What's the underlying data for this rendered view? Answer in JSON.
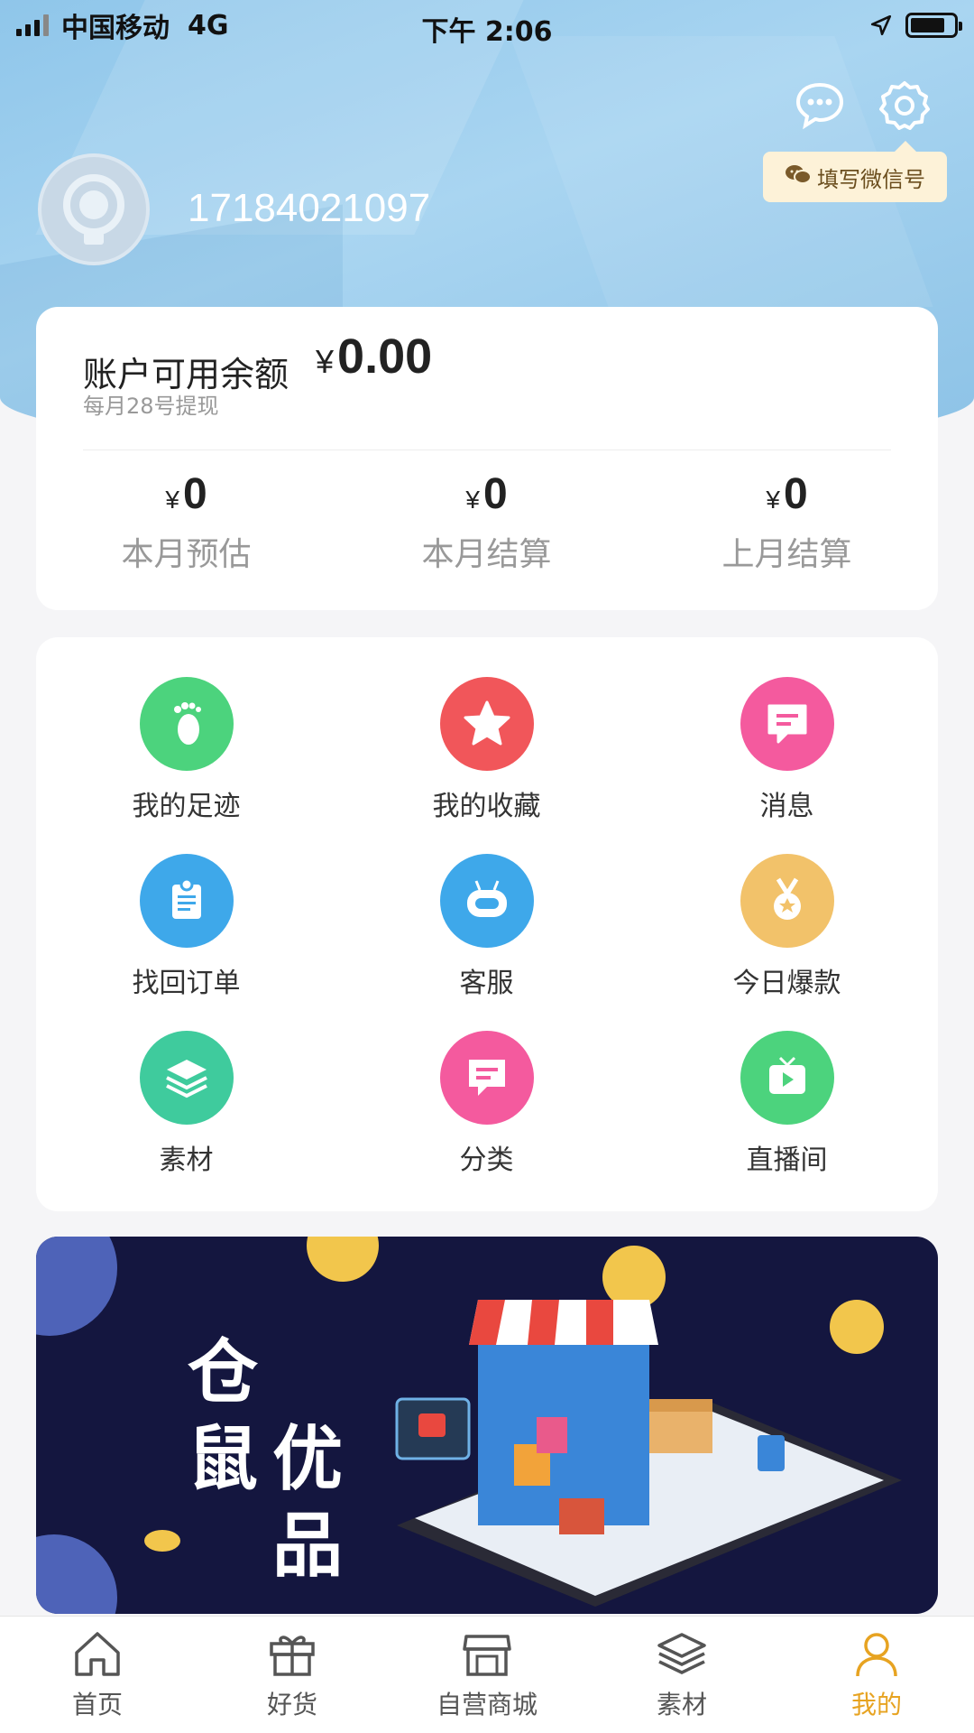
{
  "status": {
    "carrier": "中国移动",
    "network": "4G",
    "time": "下午 2:06"
  },
  "header": {
    "phone": "17184021097",
    "wechat_tip": "填写微信号"
  },
  "balance": {
    "label": "账户可用余额",
    "currency": "¥",
    "amount": "0.00",
    "withdraw_note": "每月28号提现",
    "stats": [
      {
        "currency": "¥",
        "value": "0",
        "label": "本月预估"
      },
      {
        "currency": "¥",
        "value": "0",
        "label": "本月结算"
      },
      {
        "currency": "¥",
        "value": "0",
        "label": "上月结算"
      }
    ]
  },
  "grid": [
    {
      "label": "我的足迹",
      "icon": "footprint-icon",
      "color": "#4cd37d"
    },
    {
      "label": "我的收藏",
      "icon": "star-icon",
      "color": "#f1565a"
    },
    {
      "label": "消息",
      "icon": "message-icon",
      "color": "#f45a9e"
    },
    {
      "label": "找回订单",
      "icon": "order-icon",
      "color": "#3ea8ea"
    },
    {
      "label": "客服",
      "icon": "robot-icon",
      "color": "#3ea8ea"
    },
    {
      "label": "今日爆款",
      "icon": "medal-icon",
      "color": "#f2c26a"
    },
    {
      "label": "素材",
      "icon": "layers-icon",
      "color": "#3fcb9d"
    },
    {
      "label": "分类",
      "icon": "category-icon",
      "color": "#f45a9e"
    },
    {
      "label": "直播间",
      "icon": "tv-icon",
      "color": "#4cd37d"
    }
  ],
  "banner": {
    "brand_lines": [
      "仓",
      "鼠",
      "优",
      "品"
    ]
  },
  "tabs": [
    {
      "label": "首页",
      "icon": "home-icon"
    },
    {
      "label": "好货",
      "icon": "gift-icon"
    },
    {
      "label": "自营商城",
      "icon": "store-icon"
    },
    {
      "label": "素材",
      "icon": "layers-icon"
    },
    {
      "label": "我的",
      "icon": "profile-icon",
      "active": true
    }
  ],
  "colors": {
    "accent": "#e7a321",
    "header": "#8fc6ea",
    "banner_bg": "#14163f"
  }
}
